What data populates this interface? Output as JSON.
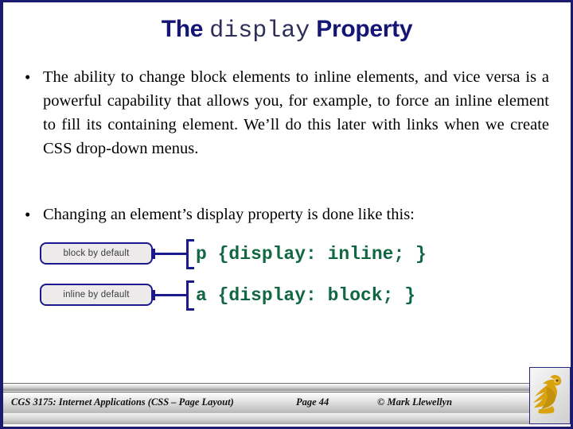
{
  "slide": {
    "border_color": "#1a1a6e",
    "background": "#ffffff",
    "title": {
      "part1": "The ",
      "code_word": "display",
      "part2": " Property",
      "color": "#151575"
    },
    "bullets": [
      {
        "marker": "•",
        "text": "The ability to change block elements to inline elements, and vice versa is a powerful capability that allows you, for example, to force an inline element to fill its containing element.  We’ll do this later with links when we create CSS drop-down menus."
      },
      {
        "marker": "•",
        "text": "Changing an element’s display property is done like this:"
      }
    ],
    "diagram": {
      "border_color": "#1a1a8c",
      "callout_fill": "#eceaea",
      "code_color": "#116644",
      "rows": [
        {
          "callout_label": "block by default",
          "code": "p {display: inline; }"
        },
        {
          "callout_label": "inline by default",
          "code": "a {display: block; }"
        }
      ]
    },
    "footer": {
      "course": "CGS 3175: Internet Applications (CSS – Page Layout)",
      "page": "Page 44",
      "copyright": "© Mark Llewellyn",
      "logo_name": "ucf-pegasus-logo",
      "logo_color": "#d9a310"
    }
  }
}
